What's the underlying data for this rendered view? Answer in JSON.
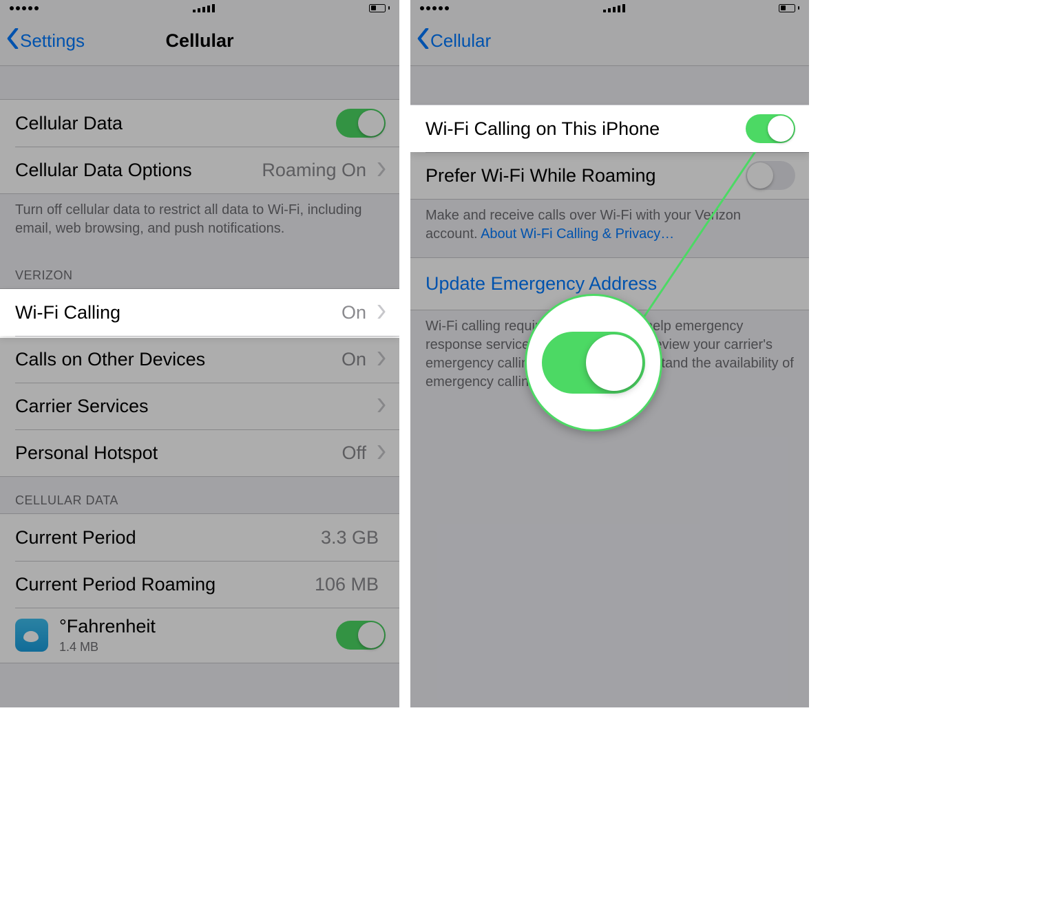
{
  "left": {
    "nav": {
      "back": "Settings",
      "title": "Cellular"
    },
    "cellular_data": {
      "label": "Cellular Data",
      "on": true
    },
    "cellular_data_options": {
      "label": "Cellular Data Options",
      "value": "Roaming On"
    },
    "footer1": "Turn off cellular data to restrict all data to Wi-Fi, including email, web browsing, and push notifications.",
    "section_verizon": "VERIZON",
    "wifi_calling": {
      "label": "Wi-Fi Calling",
      "value": "On"
    },
    "other_devices": {
      "label": "Calls on Other Devices",
      "value": "On"
    },
    "carrier_services": {
      "label": "Carrier Services"
    },
    "hotspot": {
      "label": "Personal Hotspot",
      "value": "Off"
    },
    "section_celldata": "CELLULAR DATA",
    "current_period": {
      "label": "Current Period",
      "value": "3.3 GB"
    },
    "roaming_period": {
      "label": "Current Period Roaming",
      "value": "106 MB"
    },
    "app1": {
      "name": "°Fahrenheit",
      "size": "1.4 MB",
      "on": true
    }
  },
  "right": {
    "nav": {
      "back": "Cellular",
      "title": ""
    },
    "wifi_calling_iphone": {
      "label": "Wi-Fi Calling on This iPhone",
      "on": true
    },
    "prefer_roaming": {
      "label": "Prefer Wi-Fi While Roaming",
      "on": false
    },
    "footer_desc": "Make and receive calls over Wi-Fi with your Verizon account. ",
    "footer_link": "About Wi-Fi Calling & Privacy…",
    "update_address": "Update Emergency Address",
    "footer_e911": "Wi-Fi calling requires an address to help emergency response services respond to calls. Review your carrier's emergency calling web page to understand the availability of emergency calling over Wi-Fi."
  }
}
